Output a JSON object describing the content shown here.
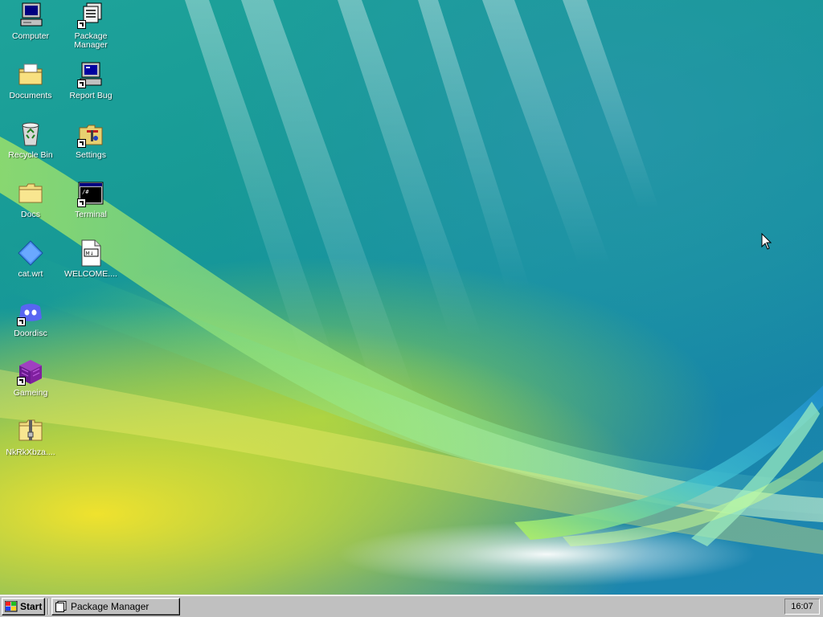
{
  "desktop": {
    "icons": [
      {
        "label": "Computer",
        "icon": "computer-icon"
      },
      {
        "label": "Package Manager",
        "icon": "package-manager-icon"
      },
      {
        "label": "Documents",
        "icon": "documents-folder-icon"
      },
      {
        "label": "Report Bug",
        "icon": "report-bug-icon"
      },
      {
        "label": "Recycle Bin",
        "icon": "recycle-bin-icon"
      },
      {
        "label": "Settings",
        "icon": "settings-icon"
      },
      {
        "label": "Docs",
        "icon": "folder-icon"
      },
      {
        "label": "Terminal",
        "icon": "terminal-icon"
      },
      {
        "label": "cat.wrt",
        "icon": "wrt-file-icon"
      },
      {
        "label": "WELCOME....",
        "icon": "markdown-file-icon"
      },
      {
        "label": "Doordisc",
        "icon": "doordisc-icon"
      },
      {
        "label": "Gameing",
        "icon": "game-cube-icon"
      },
      {
        "label": "NkRkXbza....",
        "icon": "zip-archive-icon"
      }
    ]
  },
  "taskbar": {
    "start_label": "Start",
    "tasks": [
      {
        "label": "Package Manager",
        "icon": "window-icon"
      }
    ],
    "clock": "16:07"
  },
  "colors": {
    "taskbar_gray": "#c0c0c0",
    "wallpaper_teal": "#179a96",
    "wallpaper_yellow": "#f0e030"
  }
}
